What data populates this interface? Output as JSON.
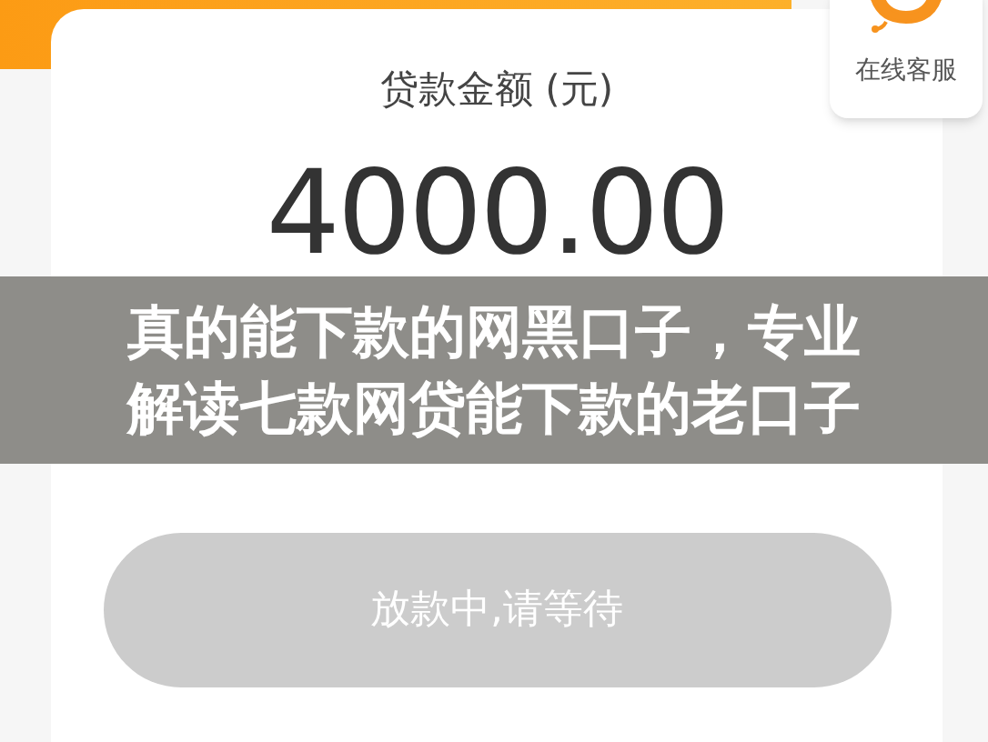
{
  "amount_card": {
    "label": "贷款金额 (元)",
    "amount": "4000.00"
  },
  "customer_service": {
    "label": "在线客服"
  },
  "banner": {
    "lines": [
      "真的能下款的网黑口子，专业",
      "解读七款网贷能下款的老口子"
    ]
  },
  "action_button": {
    "label": "放款中,请等待",
    "disabled": true
  }
}
